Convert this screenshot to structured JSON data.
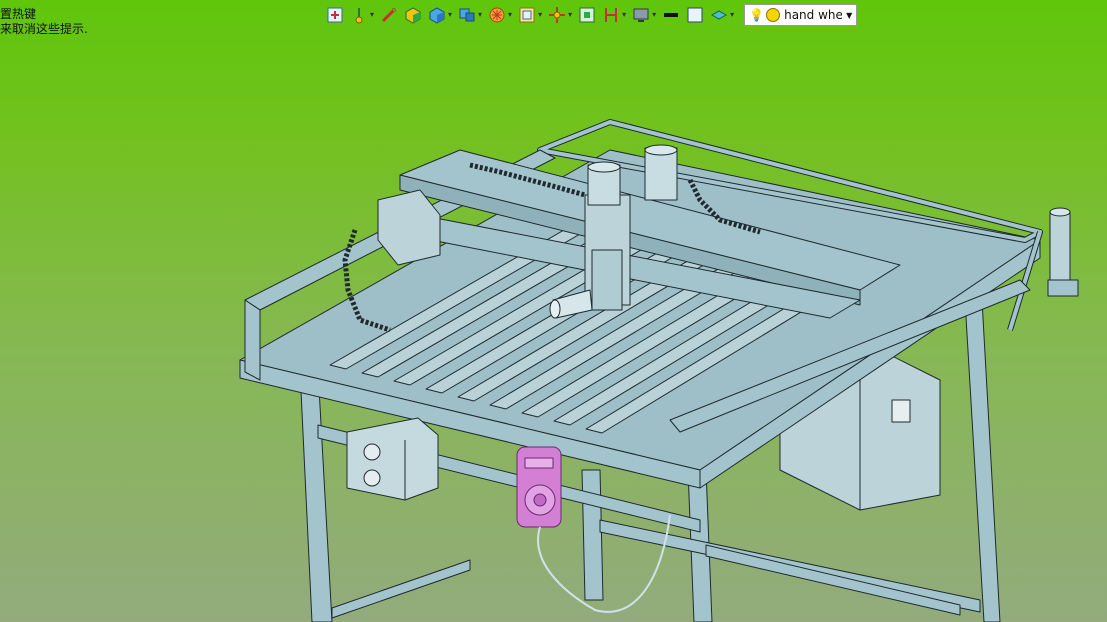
{
  "hint": {
    "line1": "置热键",
    "line2": "来取消这些提示."
  },
  "toolbar": {
    "icons": [
      "fit-all-icon",
      "normal-view-icon",
      "fly-mode-icon",
      "shading-icon",
      "iso-view-icon",
      "multi-view-icon",
      "render-style-icon",
      "hide-show-icon",
      "move-icon",
      "zoom-area-icon",
      "section-icon",
      "display-icon",
      "line-color-icon",
      "fill-color-icon",
      "layer-icon",
      "light-bulb-icon"
    ],
    "light_source": {
      "value": "hand whee"
    }
  },
  "colors": {
    "bg_top": "#5fc60b",
    "bg_bottom": "#93ab7d",
    "frame": "#a3c4cc",
    "frame_edge": "#1e2a2e",
    "handwheel": "#d27fd4",
    "box": "#bcd4d9"
  }
}
